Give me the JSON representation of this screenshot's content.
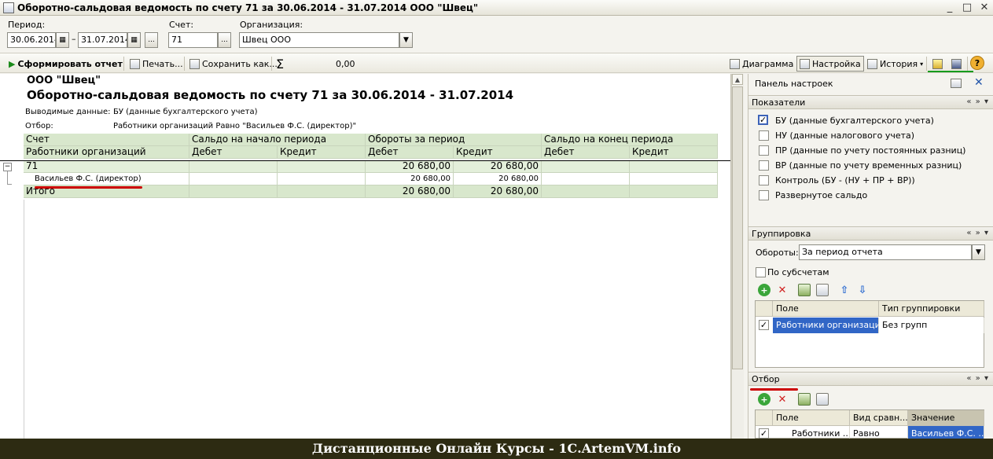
{
  "window": {
    "title": "Оборотно-сальдовая ведомость по счету 71 за 30.06.2014 - 31.07.2014 ООО \"Швец\"",
    "controls": [
      "_",
      "□",
      "✕"
    ]
  },
  "params": {
    "period_label": "Период:",
    "date_from": "30.06.2014",
    "dash": "–",
    "date_to": "31.07.2014",
    "period_btn": "...",
    "account_label": "Счет:",
    "account": "71",
    "account_btn": "...",
    "org_label": "Организация:",
    "org": "Швец ООО"
  },
  "toolbar": {
    "generate": "Сформировать отчет",
    "print": "Печать...",
    "save": "Сохранить как...",
    "sigma": "Σ",
    "sum": "0,00",
    "diagram": "Диаграмма",
    "settings": "Настройка",
    "history": "История",
    "help": "?"
  },
  "report": {
    "org": "ООО \"Швец\"",
    "title": "Оборотно-сальдовая ведомость по счету 71 за 30.06.2014 - 31.07.2014",
    "output_label": "Выводимые данные:",
    "output_value": "БУ (данные бухгалтерского учета)",
    "filter_label": "Отбор:",
    "filter_value": "Работники организаций Равно \"Васильев Ф.С. (директор)\"",
    "header1": [
      "Счет",
      "Сальдо на начало периода",
      "Обороты за период",
      "Сальдо на конец периода"
    ],
    "header2": [
      "Работники организаций",
      "Дебет",
      "Кредит",
      "Дебет",
      "Кредит",
      "Дебет",
      "Кредит"
    ],
    "rows": [
      {
        "name": "71",
        "values": [
          "",
          "",
          "20 680,00",
          "20 680,00",
          "",
          ""
        ]
      },
      {
        "name": "Васильев Ф.С. (директор)",
        "values": [
          "",
          "",
          "20 680,00",
          "20 680,00",
          "",
          ""
        ]
      }
    ],
    "total": {
      "name": "Итого",
      "values": [
        "",
        "",
        "20 680,00",
        "20 680,00",
        "",
        ""
      ]
    },
    "tree_toggle": "−"
  },
  "panel": {
    "title": "Панель настроек",
    "indicators_title": "Показатели",
    "indicators": [
      {
        "label": "БУ (данные бухгалтерского учета)",
        "checked": true
      },
      {
        "label": "НУ (данные налогового учета)",
        "checked": false
      },
      {
        "label": "ПР (данные по учету постоянных разниц)",
        "checked": false
      },
      {
        "label": "ВР (данные по учету временных разниц)",
        "checked": false
      },
      {
        "label": "Контроль (БУ - (НУ + ПР + ВР))",
        "checked": false
      },
      {
        "label": "Развернутое сальдо",
        "checked": false
      }
    ],
    "grouping_title": "Группировка",
    "turnover_label": "Обороты:",
    "turnover_value": "За период отчета",
    "subaccounts_label": "По субсчетам",
    "grouping_cols": [
      "Поле",
      "Тип группировки"
    ],
    "grouping_rows": [
      {
        "field": "Работники организаций",
        "type": "Без групп"
      }
    ],
    "filter_title": "Отбор",
    "filter_cols": [
      "Поле",
      "Вид сравн...",
      "Значение"
    ],
    "filter_rows": [
      {
        "field": "Работники ...",
        "cmp": "Равно",
        "value": "Васильев Ф.С. ..."
      }
    ],
    "nav": "« » ▾"
  },
  "footer": {
    "text": "Дистанционные Онлайн Курсы - 1С.ArtemVM.info"
  }
}
